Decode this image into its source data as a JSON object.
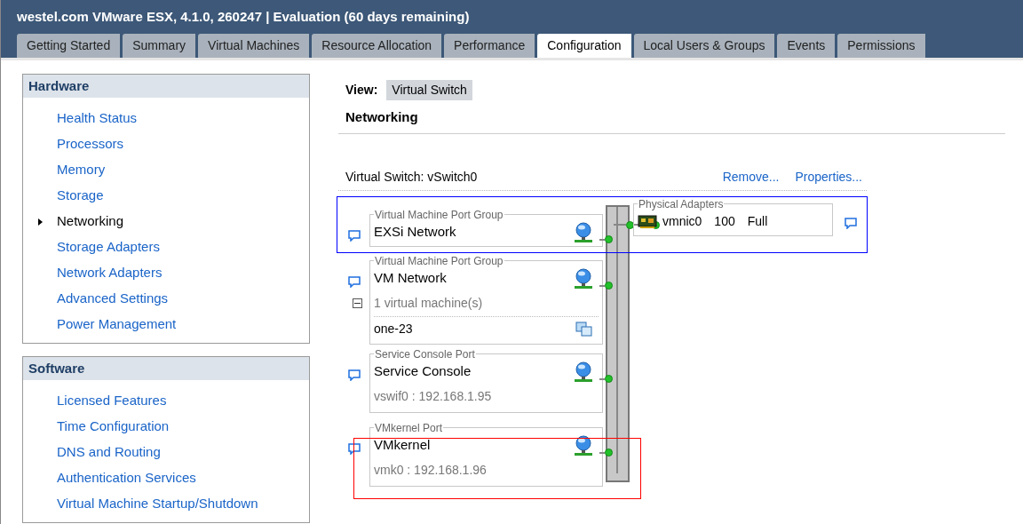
{
  "window": {
    "title": "westel.com VMware ESX, 4.1.0, 260247 | Evaluation (60 days remaining)"
  },
  "tabs": [
    {
      "label": "Getting Started",
      "selected": false
    },
    {
      "label": "Summary",
      "selected": false
    },
    {
      "label": "Virtual Machines",
      "selected": false
    },
    {
      "label": "Resource Allocation",
      "selected": false
    },
    {
      "label": "Performance",
      "selected": false
    },
    {
      "label": "Configuration",
      "selected": true
    },
    {
      "label": "Local Users & Groups",
      "selected": false
    },
    {
      "label": "Events",
      "selected": false
    },
    {
      "label": "Permissions",
      "selected": false
    }
  ],
  "sidebar": [
    {
      "title": "Hardware",
      "items": [
        {
          "label": "Health Status",
          "selected": false
        },
        {
          "label": "Processors",
          "selected": false
        },
        {
          "label": "Memory",
          "selected": false
        },
        {
          "label": "Storage",
          "selected": false
        },
        {
          "label": "Networking",
          "selected": true
        },
        {
          "label": "Storage Adapters",
          "selected": false
        },
        {
          "label": "Network Adapters",
          "selected": false
        },
        {
          "label": "Advanced Settings",
          "selected": false
        },
        {
          "label": "Power Management",
          "selected": false
        }
      ]
    },
    {
      "title": "Software",
      "items": [
        {
          "label": "Licensed Features",
          "selected": false
        },
        {
          "label": "Time Configuration",
          "selected": false
        },
        {
          "label": "DNS and Routing",
          "selected": false
        },
        {
          "label": "Authentication Services",
          "selected": false
        },
        {
          "label": "Virtual Machine Startup/Shutdown",
          "selected": false
        }
      ]
    }
  ],
  "view": {
    "label": "View:",
    "value": "Virtual Switch"
  },
  "section_title": "Networking",
  "switch": {
    "label": "Virtual Switch: vSwitch0",
    "links": [
      "Remove...",
      "Properties..."
    ],
    "port_groups": [
      {
        "kind": "vm",
        "legend": "Virtual Machine Port Group",
        "name": "EXSi Network",
        "color": "#0000ff"
      },
      {
        "kind": "vm",
        "legend": "Virtual Machine Port Group",
        "name": "VM Network",
        "vm_count": "1 virtual machine(s)",
        "expanded": true,
        "vms": [
          "one-23"
        ]
      },
      {
        "kind": "ip",
        "legend": "Service Console Port",
        "name": "Service Console",
        "address": "vswif0 : 192.168.1.95"
      },
      {
        "kind": "ip",
        "legend": "VMkernel Port",
        "name": "VMkernel",
        "address": "vmk0 : 192.168.1.96",
        "color": "#ff0000"
      }
    ],
    "physical_adapters": {
      "legend": "Physical Adapters",
      "adapters": [
        {
          "name": "vmnic0",
          "speed": "100",
          "duplex": "Full"
        }
      ]
    }
  }
}
